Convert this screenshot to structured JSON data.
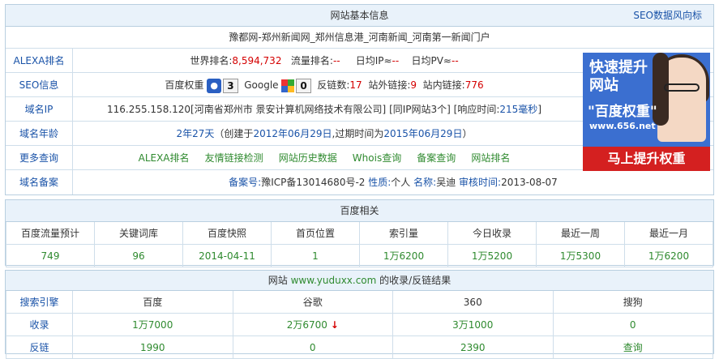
{
  "basic": {
    "title": "网站基本信息",
    "seo_link": "SEO数据风向标",
    "site_title": "豫都网-郑州新闻网_郑州信息港_河南新闻_河南第一新闻门户",
    "alexa": {
      "label": "ALEXA排名",
      "world_rank_label": "世界排名:",
      "world_rank": "8,594,732",
      "traffic_label": "流量排名:",
      "traffic": "--",
      "daily_ip_label": "日均IP≈",
      "daily_ip": "--",
      "daily_pv_label": "日均PV≈",
      "daily_pv": "--"
    },
    "seo": {
      "label": "SEO信息",
      "baidu_weight_label": "百度权重",
      "baidu_weight": "3",
      "google_label": "Google",
      "google_pr": "0",
      "backlinks_label": "反链数:",
      "backlinks": "17",
      "outlinks_label": "站外链接:",
      "outlinks": "9",
      "inlinks_label": "站内链接:",
      "inlinks": "776"
    },
    "ip": {
      "label": "域名IP",
      "value": "116.255.158.120[河南省郑州市 景安计算机网络技术有限公司]",
      "same_ip": "[同IP网站3个]",
      "resp_label": "[响应时间:",
      "resp_value": "215毫秒",
      "resp_end": "]"
    },
    "age": {
      "label": "域名年龄",
      "value": "2年27天",
      "detail_prefix": "（创建于",
      "created": "2012年06月29日",
      "detail_mid": ",过期时间为",
      "expires": "2015年06月29日",
      "detail_suffix": "）"
    },
    "more": {
      "label": "更多查询",
      "links": [
        "ALEXA排名",
        "友情链接检测",
        "网站历史数据",
        "Whois查询",
        "备案查询",
        "网站排名"
      ]
    },
    "icp": {
      "label": "域名备案",
      "no_label": "备案号:",
      "no": "豫ICP备13014680号-2",
      "nature_label": "性质:",
      "nature": "个人",
      "name_label": "名称:",
      "name": "吴迪",
      "date_label": "审核时间:",
      "date": "2013-08-07"
    }
  },
  "ad": {
    "line1": "快速提升",
    "line2": "网站",
    "line3": "\"百度权重\"",
    "url": "www.656.net",
    "banner": "马上提升权重"
  },
  "baidu": {
    "title": "百度相关",
    "headers": [
      "百度流量预计",
      "关键词库",
      "百度快照",
      "首页位置",
      "索引量",
      "今日收录",
      "最近一周",
      "最近一月"
    ],
    "values": [
      "749",
      "96",
      "2014-04-11",
      "1",
      "1万6200",
      "1万5200",
      "1万5300",
      "1万6200"
    ]
  },
  "search": {
    "title_prefix": "网站",
    "domain": "www.yuduxx.com",
    "title_suffix": "的收录/反链结果",
    "engine_label": "搜索引擎",
    "engines": [
      "百度",
      "谷歌",
      "360",
      "搜狗"
    ],
    "index_label": "收录",
    "index": [
      "1万7000",
      "2万6700",
      "3万1000",
      "0"
    ],
    "backlink_label": "反链",
    "backlink": [
      "1990",
      "0",
      "2390",
      "查询"
    ]
  },
  "colors": {
    "accent": "#1a53a8",
    "value_green": "#2f8a2f",
    "alert_red": "#d40000",
    "header_bg": "#e9f2fa",
    "border": "#b9cfe0"
  }
}
